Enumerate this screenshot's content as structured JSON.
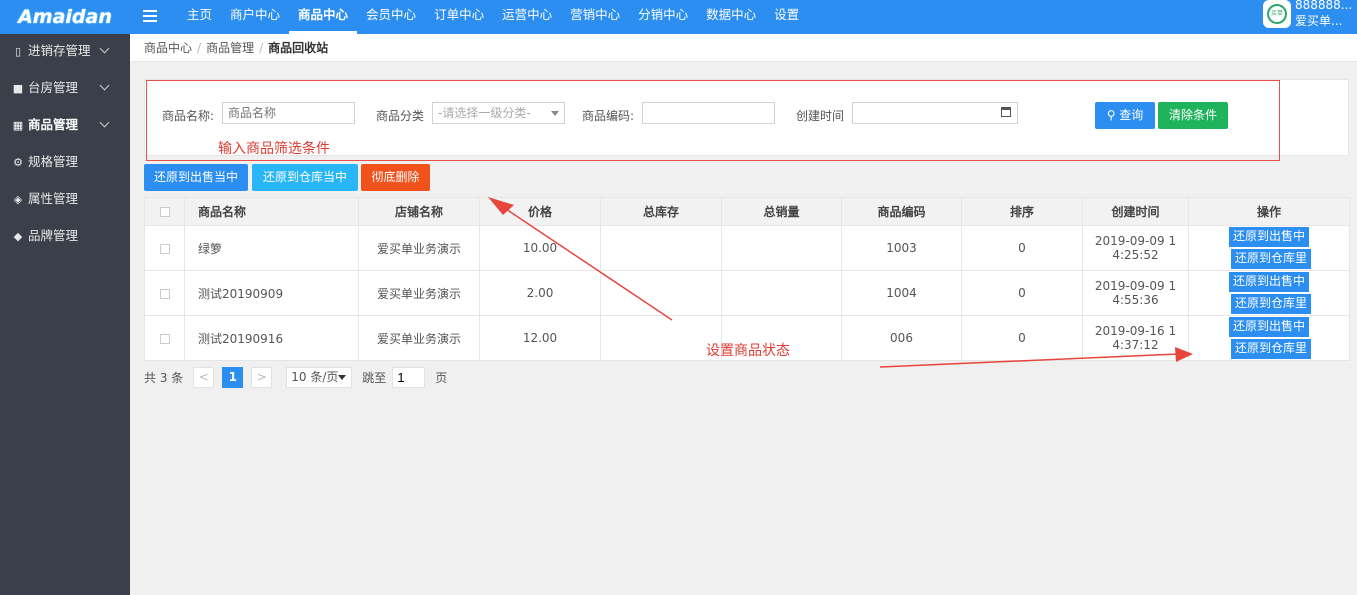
{
  "brand": {
    "logo_text": "Amaidan"
  },
  "topnav": {
    "items": [
      "主页",
      "商户中心",
      "商品中心",
      "会员中心",
      "订单中心",
      "运营中心",
      "营销中心",
      "分销中心",
      "数据中心",
      "设置"
    ],
    "active_index": 2
  },
  "user": {
    "line1": "888888...",
    "line2": "爱买单...",
    "avatar_text": "买单"
  },
  "sidebar": {
    "items": [
      {
        "label": "进销存管理",
        "icon": "map-icon",
        "glyph": "▯",
        "expandable": true
      },
      {
        "label": "台房管理",
        "icon": "bookmark-icon",
        "glyph": "■",
        "expandable": true
      },
      {
        "label": "商品管理",
        "icon": "grid-icon",
        "glyph": "▦",
        "expandable": true,
        "active": true
      },
      {
        "label": "规格管理",
        "icon": "cubes-icon",
        "glyph": "⚙",
        "expandable": false
      },
      {
        "label": "属性管理",
        "icon": "cube-icon",
        "glyph": "◈",
        "expandable": false
      },
      {
        "label": "品牌管理",
        "icon": "tag-icon",
        "glyph": "◆",
        "expandable": false
      }
    ]
  },
  "breadcrumb": [
    "商品中心",
    "商品管理",
    "商品回收站"
  ],
  "filter": {
    "name_label": "商品名称:",
    "name_placeholder": "商品名称",
    "category_label": "商品分类",
    "category_value": "-请选择一级分类-",
    "code_label": "商品编码:",
    "code_value": "",
    "date_label": "创建时间",
    "date_value": "",
    "search_label": "查询",
    "clear_label": "清除条件"
  },
  "annotations": {
    "filter_hint": "输入商品筛选条件",
    "status_hint": "设置商品状态"
  },
  "actions": {
    "restore_sale": "还原到出售当中",
    "restore_stock": "还原到仓库当中",
    "delete": "彻底删除"
  },
  "colors": {
    "primary": "#2b8ef0",
    "restore_stock_btn": "#29b6f6",
    "delete_btn": "#f1511b",
    "clear_btn": "#1fb35c",
    "annotation_red": "#e03c32",
    "sidebar_bg": "#3a3f4a"
  },
  "table": {
    "headers": [
      "",
      "商品名称",
      "店铺名称",
      "价格",
      "总库存",
      "总销量",
      "商品编码",
      "排序",
      "创建时间",
      "操作"
    ],
    "rows": [
      {
        "name": "绿箩",
        "shop": "爱买单业务演示",
        "price": "10.00",
        "stock": "",
        "sales": "",
        "code": "1003",
        "sort": "0",
        "time1": "2019-09-09 1",
        "time2": "4:25:52"
      },
      {
        "name": "测试20190909",
        "shop": "爱买单业务演示",
        "price": "2.00",
        "stock": "",
        "sales": "",
        "code": "1004",
        "sort": "0",
        "time1": "2019-09-09 1",
        "time2": "4:55:36"
      },
      {
        "name": "测试20190916",
        "shop": "爱买单业务演示",
        "price": "12.00",
        "stock": "",
        "sales": "",
        "code": "006",
        "sort": "0",
        "time1": "2019-09-16 1",
        "time2": "4:37:12"
      }
    ],
    "op_sale": "还原到出售中",
    "op_stock": "还原到仓库里"
  },
  "pagination": {
    "total": "共 3 条",
    "current_page": "1",
    "prev": "<",
    "next": ">",
    "page_size": "10 条/页",
    "jump_label": "跳至",
    "jump_value": "1",
    "page_suffix": "页"
  }
}
